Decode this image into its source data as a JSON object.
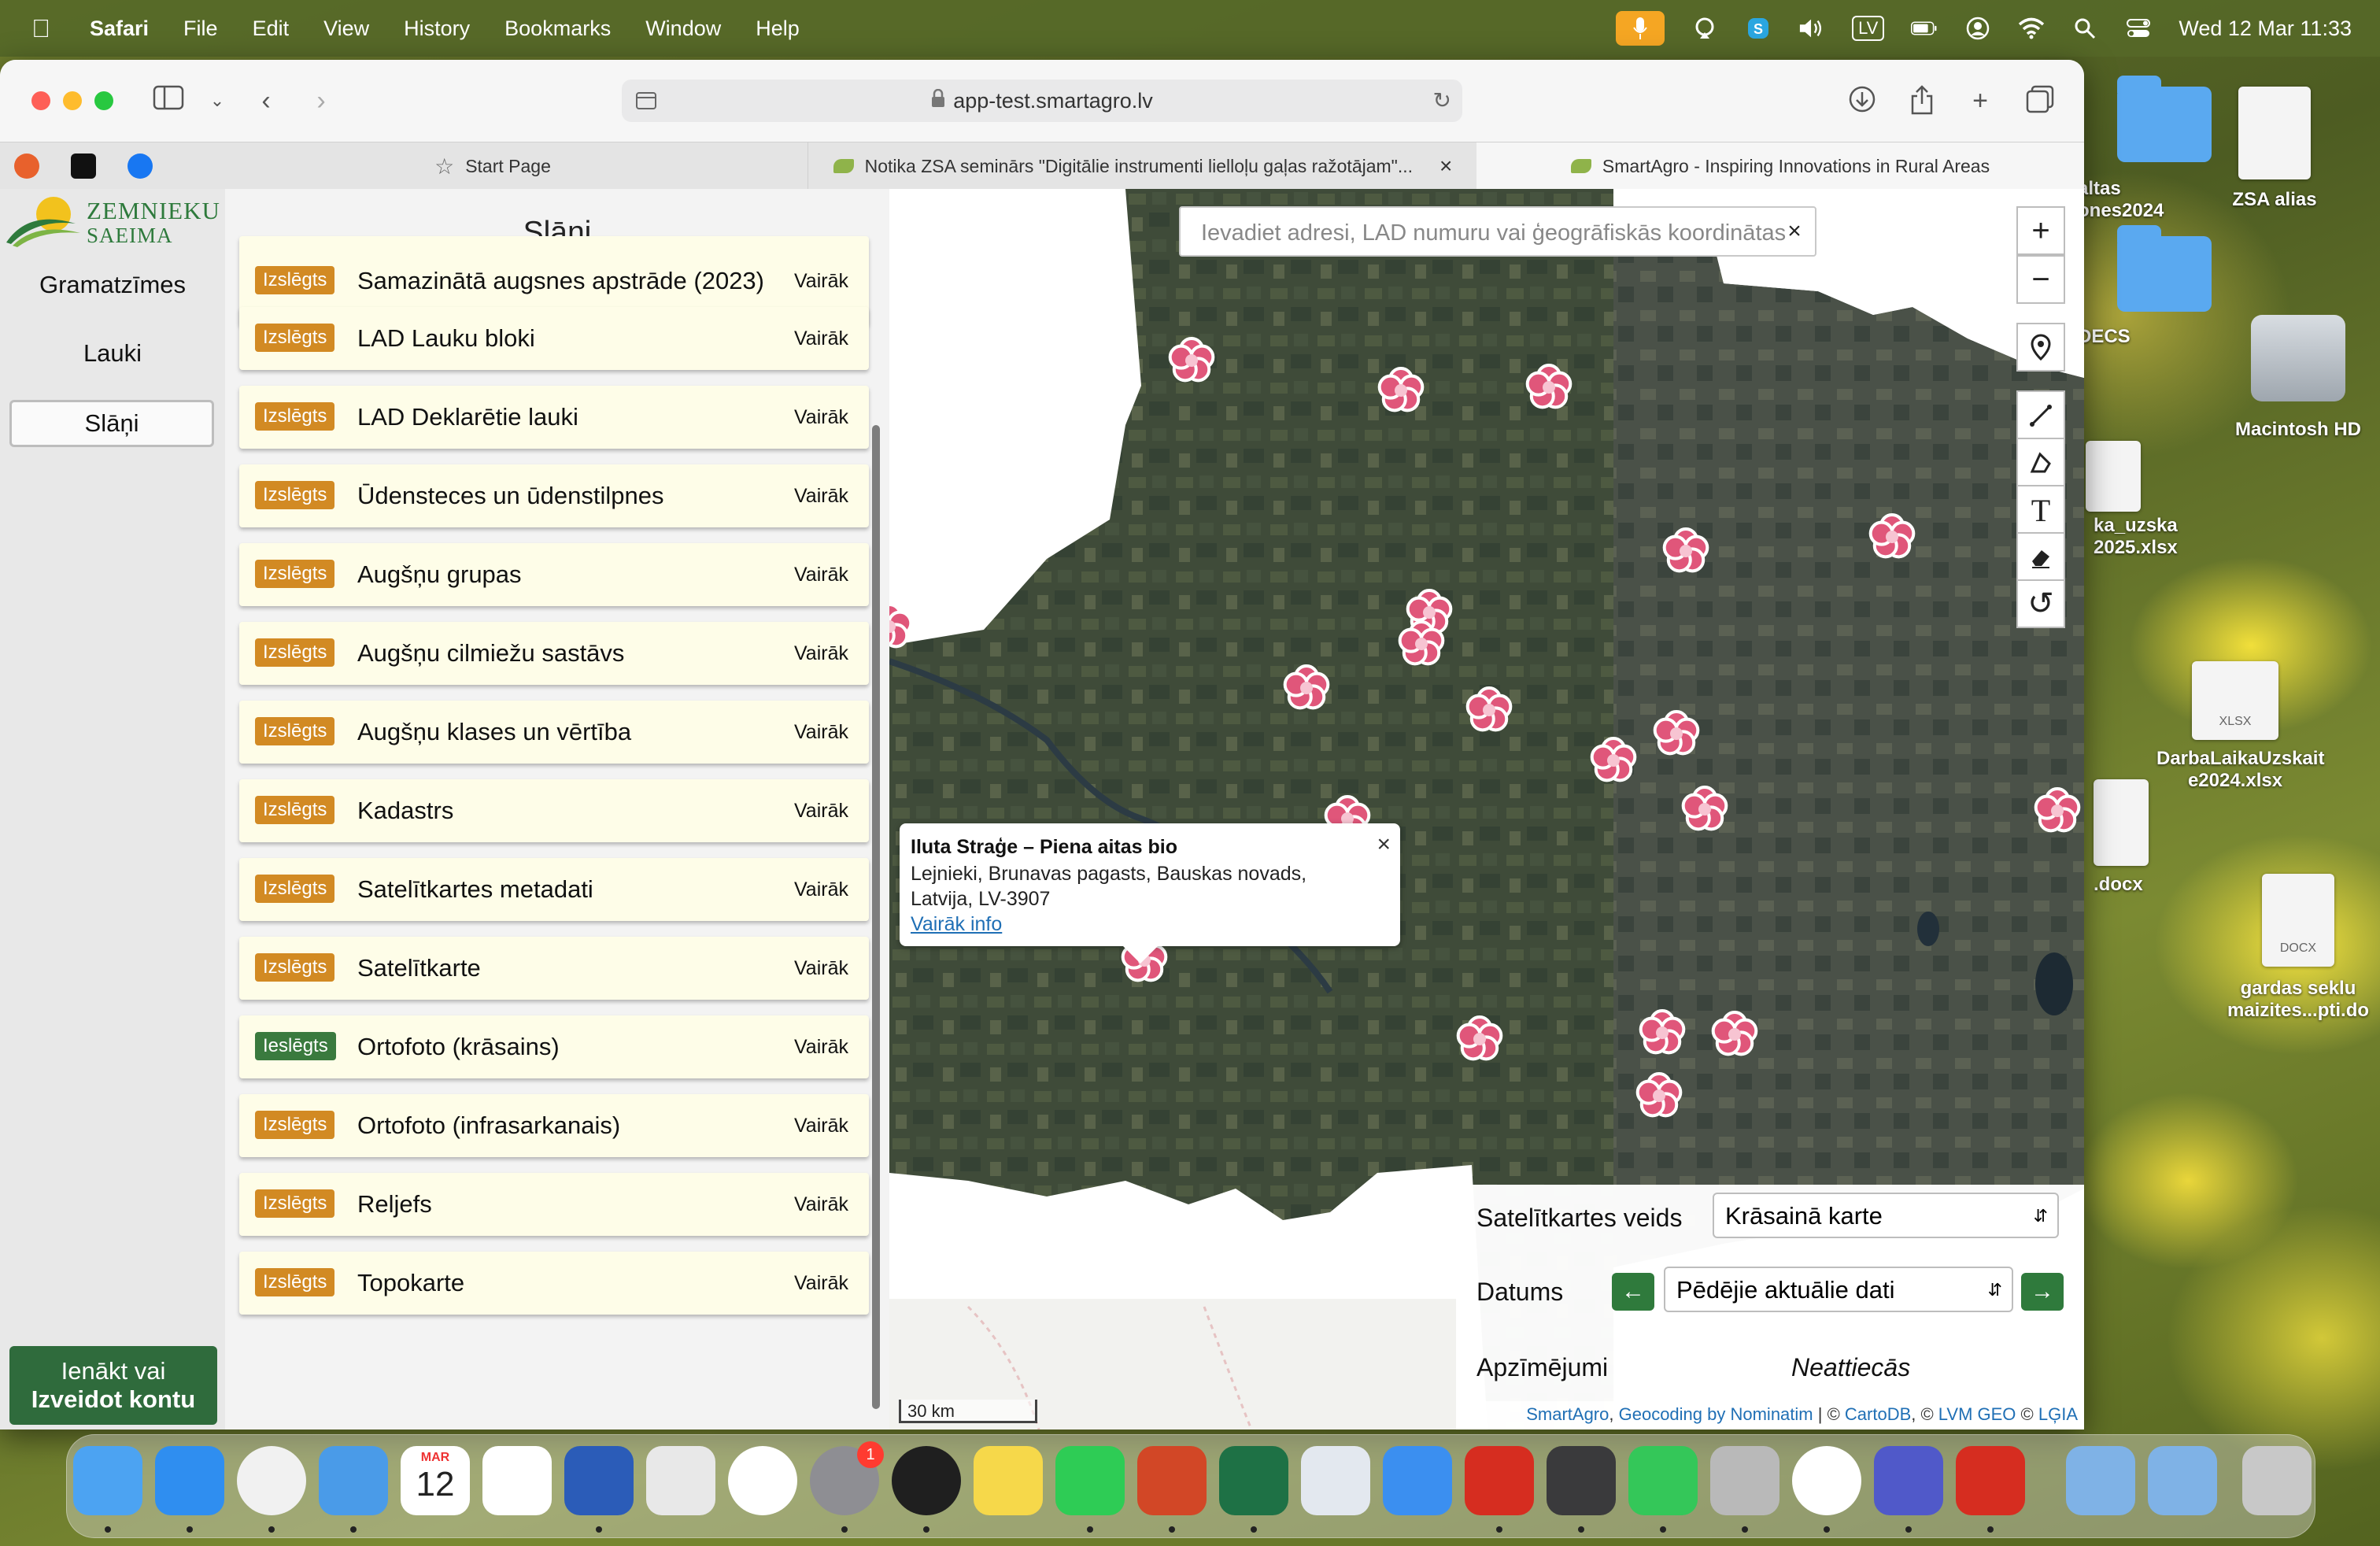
{
  "menubar": {
    "app": "Safari",
    "items": [
      "File",
      "Edit",
      "View",
      "History",
      "Bookmarks",
      "Window",
      "Help"
    ],
    "input_source": "LV",
    "datetime": "Wed 12 Mar  11:33",
    "icons": [
      "apple-icon",
      "mic-icon",
      "airplay-icon",
      "skype-icon",
      "volume-icon",
      "input-lv",
      "battery-icon",
      "user-icon",
      "wifi-icon",
      "spotlight-icon",
      "control-center-icon"
    ]
  },
  "desktop": {
    "items": [
      {
        "name": "ZSA alias",
        "kind": "doc"
      },
      {
        "name": "altas\nones2024",
        "kind": "folder"
      },
      {
        "name": "DECS",
        "kind": "folder"
      },
      {
        "name": "Macintosh HD",
        "kind": "disk"
      },
      {
        "name": "ka_uzska\n2025.xlsx",
        "kind": "doc"
      },
      {
        "name": "DarbaLaikaUzskait\ne2024.xlsx",
        "kind": "doc",
        "badge": "XLSX"
      },
      {
        "name": ".docx",
        "kind": "doc"
      },
      {
        "name": "gardas seklu\nmaizites...pti.do",
        "kind": "doc",
        "badge": "DOCX"
      }
    ]
  },
  "browser": {
    "url": "app-test.smartagro.lv",
    "tabs": [
      {
        "label": "Start Page",
        "active": false
      },
      {
        "label": "Notika ZSA seminārs \"Digitālie instrumenti lielloļu gaļas ražotājam\"...",
        "active": false
      },
      {
        "label": "SmartAgro - Inspiring Innovations in Rural Areas",
        "active": true
      }
    ]
  },
  "app": {
    "logo_line1": "ZEMNIEKU",
    "logo_line2": "SAEIMA",
    "nav": [
      "Gramatzīmes",
      "Lauki",
      "Slāņi"
    ],
    "nav_selected": "Slāņi",
    "login_line1": "Ienākt vai",
    "login_line2": "Izveidot kontu",
    "panel_title": "Slāņi",
    "more_label": "Vairāk",
    "layers": [
      {
        "name": "Samazinātā augsnes apstrāde (2023)",
        "status": "Izslēgts"
      },
      {
        "name": "LAD Lauku bloki",
        "status": "Izslēgts"
      },
      {
        "name": "LAD Deklarētie lauki",
        "status": "Izslēgts"
      },
      {
        "name": "Ūdensteces un ūdenstilpnes",
        "status": "Izslēgts"
      },
      {
        "name": "Augšņu grupas",
        "status": "Izslēgts"
      },
      {
        "name": "Augšņu cilmiežu sastāvs",
        "status": "Izslēgts"
      },
      {
        "name": "Augšņu klases un vērtība",
        "status": "Izslēgts"
      },
      {
        "name": "Kadastrs",
        "status": "Izslēgts"
      },
      {
        "name": "Satelītkartes metadati",
        "status": "Izslēgts"
      },
      {
        "name": "Satelītkarte",
        "status": "Izslēgts"
      },
      {
        "name": "Ortofoto (krāsains)",
        "status": "Ieslēgts"
      },
      {
        "name": "Ortofoto (infrasarkanais)",
        "status": "Izslēgts"
      },
      {
        "name": "Reljefs",
        "status": "Izslēgts"
      },
      {
        "name": "Topokarte",
        "status": "Izslēgts"
      }
    ],
    "map": {
      "search_placeholder": "Ievadiet adresi, LAD numuru vai ģeogrāfiskās koordinātas",
      "popup": {
        "title": "Iluta Straģe – Piena aitas bio",
        "address": "Lejnieki, Brunavas pagasts, Bauskas novads, Latvija, LV-3907",
        "link": "Vairāk info"
      },
      "controls": {
        "sat_type_label": "Satelītkartes veids",
        "sat_type_value": "Krāsainā karte",
        "date_label": "Datums",
        "date_value": "Pēdējie aktuālie dati",
        "legend_label": "Apzīmējumi",
        "legend_value": "Neattiecās"
      },
      "scale": "30 km",
      "attribution": {
        "smartagro": "SmartAgro",
        "geocoding": "Geocoding by Nominatim",
        "cartodb": "CartoDB",
        "lvm": "LVM GEO",
        "lgia": "LĢIA",
        "sep": " | © ",
        "sep2": ", © ",
        "sep3": " © "
      },
      "marker_color": "#e0567a"
    }
  },
  "dock": {
    "apps": [
      "Finder",
      "Safari",
      "Chrome",
      "Mail",
      "Calendar",
      "Reminders",
      "Word",
      "Launchpad",
      "Photos",
      "System Settings",
      "Passwords",
      "Notes",
      "WhatsApp",
      "PowerPoint",
      "Excel",
      "Preview",
      "Maps",
      "Acrobat",
      "Print Center",
      "Messages",
      "WhatsApp 2",
      "e-app",
      "Teams",
      "Acrobat 2",
      "Applications",
      "Downloads",
      "Trash"
    ],
    "calendar_month": "MAR",
    "calendar_day": "12",
    "settings_badge": "1"
  }
}
